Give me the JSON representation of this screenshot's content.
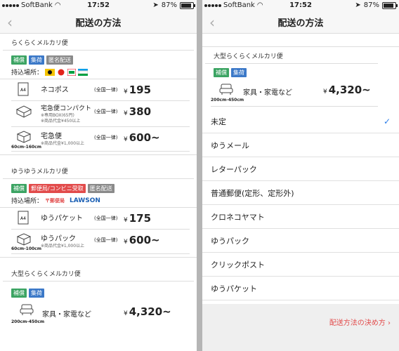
{
  "status": {
    "carrier": "SoftBank",
    "time": "17:52",
    "battery": "87%"
  },
  "nav": {
    "title": "配送の方法"
  },
  "left": {
    "rakuraku": {
      "title": "らくらくメルカリ便",
      "badges": [
        "補償",
        "集荷",
        "匿名配送"
      ],
      "pickup_label": "持込場所：",
      "rows": [
        {
          "name": "ネコポス",
          "flat": "(全国一律)",
          "yen": "¥",
          "price": "195",
          "size_tag": "A4"
        },
        {
          "name": "宅急便コンパクト",
          "note1": "※専用BOX(65円)",
          "note2": "※商品代金¥450以上",
          "flat": "(全国一律)",
          "yen": "¥",
          "price": "380"
        },
        {
          "name": "宅急便",
          "note1": "※商品代金¥1,000以上",
          "flat": "(全国一律)",
          "yen": "¥",
          "price": "600~",
          "size": "60cm-160cm"
        }
      ]
    },
    "yuyu": {
      "title": "ゆうゆうメルカリ便",
      "badges": [
        "補償",
        "郵便局/コンビニ受取",
        "匿名配送"
      ],
      "pickup_label": "持込場所：",
      "logos": [
        "郵便局",
        "LAWSON"
      ],
      "rows": [
        {
          "name": "ゆうパケット",
          "flat": "(全国一律)",
          "yen": "¥",
          "price": "175",
          "size_tag": "A4"
        },
        {
          "name": "ゆうパック",
          "note1": "※商品代金¥1,000以上",
          "flat": "(全国一律)",
          "yen": "¥",
          "price": "600~",
          "size": "60cm-100cm"
        }
      ]
    },
    "large": {
      "title": "大型らくらくメルカリ便",
      "badges": [
        "補償",
        "集荷"
      ],
      "row": {
        "name": "家具・家電など",
        "yen": "¥",
        "price": "4,320~",
        "size": "200cm-450cm"
      }
    }
  },
  "right": {
    "large": {
      "title": "大型らくらくメルカリ便",
      "badges": [
        "補償",
        "集荷"
      ],
      "row": {
        "name": "家具・家電など",
        "yen": "¥",
        "price": "4,320~",
        "size": "200cm-450cm"
      }
    },
    "choices": [
      "未定",
      "ゆうメール",
      "レターパック",
      "普通郵便(定形、定形外)",
      "クロネコヤマト",
      "ゆうパック",
      "クリックポスト",
      "ゆうパケット"
    ],
    "selected": "未定",
    "footer_link": "配送方法の決め方 ›"
  },
  "colors": {
    "green": "#3ca463",
    "blue": "#3c79c8",
    "gray": "#8a8a8a",
    "red": "#e24b4b",
    "check": "#2b7de9"
  }
}
